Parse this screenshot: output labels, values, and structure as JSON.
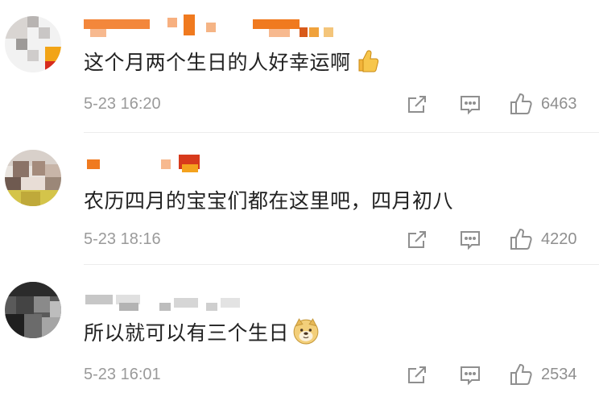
{
  "comments": [
    {
      "text": "这个月两个生日的人好幸运啊",
      "emoji": "thumbs-up-icon",
      "time": "5-23 16:20",
      "likes": "6463"
    },
    {
      "text": "农历四月的宝宝们都在这里吧，四月初八",
      "time": "5-23 18:16",
      "likes": "4220"
    },
    {
      "text": "所以就可以有三个生日",
      "emoji": "doge-icon",
      "time": "5-23 16:01",
      "likes": "2534"
    }
  ],
  "colors": {
    "text": "#222222",
    "meta": "#9a9a9a",
    "icon": "#8f8f8f",
    "name_blur_orange": "#f07a1f"
  }
}
